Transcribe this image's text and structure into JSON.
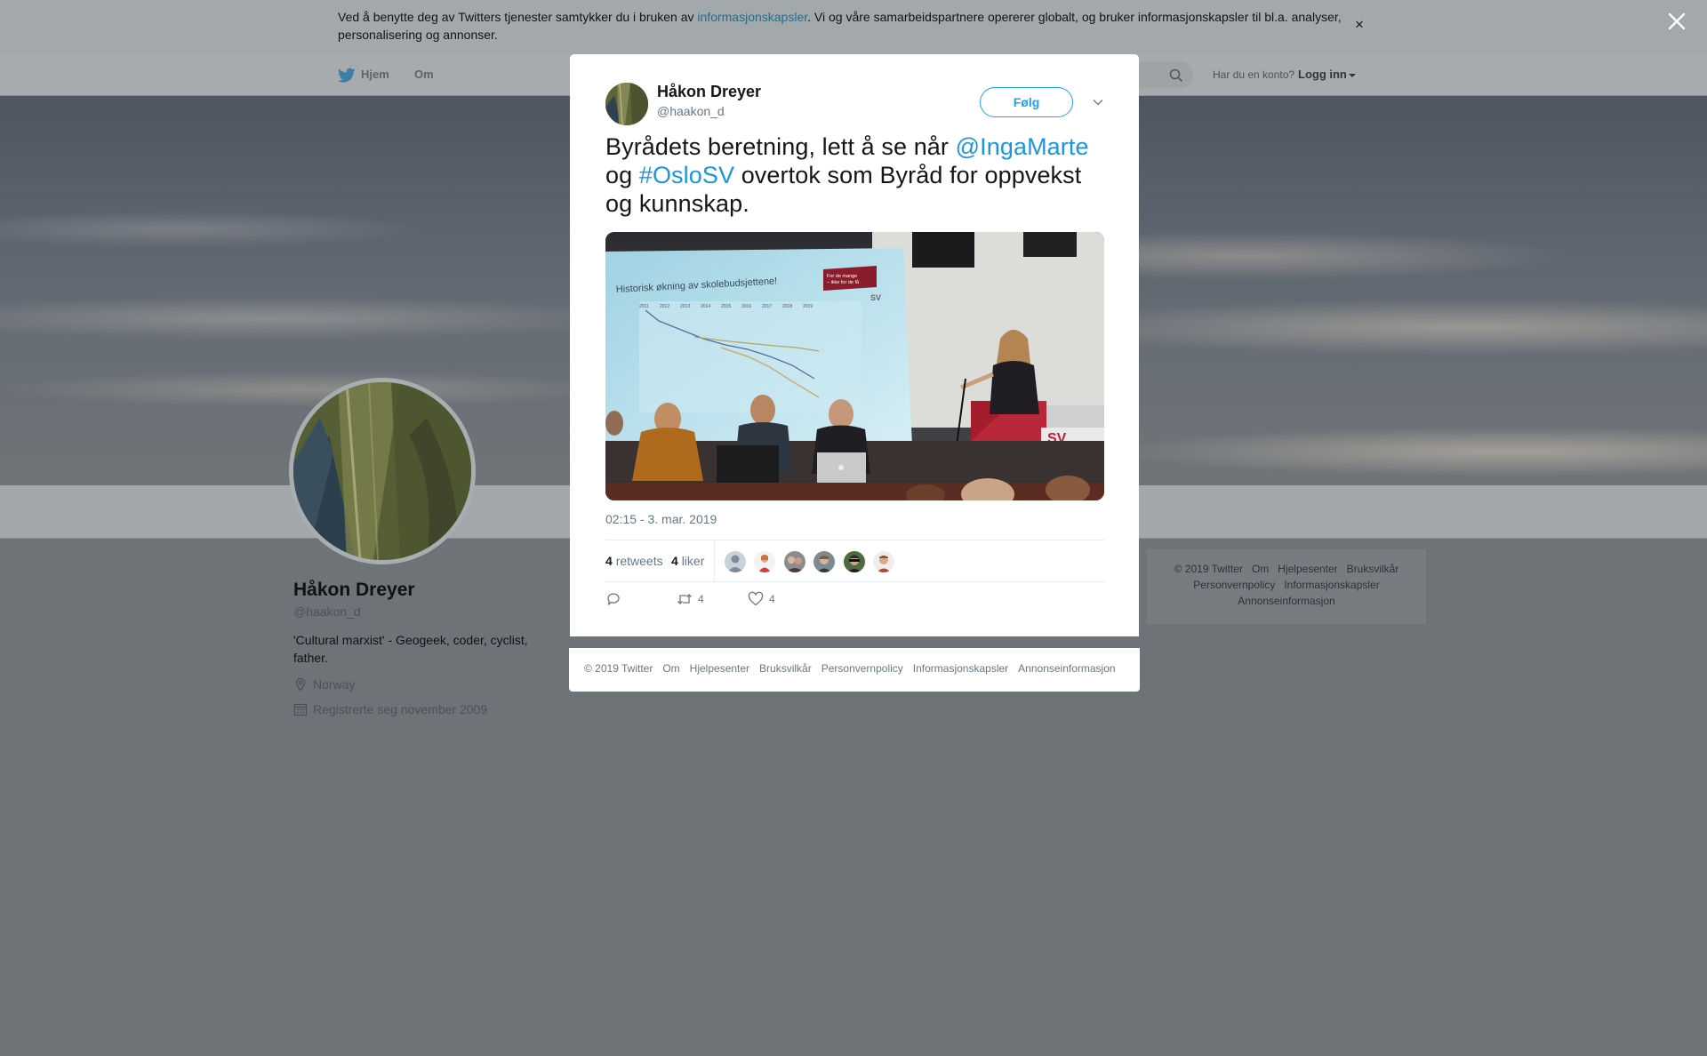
{
  "cookie": {
    "text_before": "Ved å benytte deg av Twitters tjenester samtykker du i bruken av ",
    "link": "informasjonskapsler",
    "text_after": ". Vi og våre samarbeidspartnere opererer globalt, og bruker informasjonskapsler til bl.a. analyser, personalisering og annonser.",
    "close": "×"
  },
  "nav": {
    "home": "Hjem",
    "about": "Om",
    "account_prompt": "Har du en konto?",
    "login": "Logg inn"
  },
  "profile": {
    "name": "Håkon Dreyer",
    "handle": "@haakon_d",
    "bio": "'Cultural marxist' - Geogeek, coder, cyclist, father.",
    "location": "Norway",
    "joined": "Registrerte seg november 2009"
  },
  "side_footer": {
    "row1": [
      "© 2019 Twitter",
      "Om",
      "Hjelpesenter",
      "Bruksvilkår"
    ],
    "row2": [
      "Personvernpolicy",
      "Informasjonskapsler"
    ],
    "row3": [
      "Annonseinformasjon"
    ]
  },
  "tweet": {
    "author_name": "Håkon Dreyer",
    "author_handle": "@haakon_d",
    "follow_label": "Følg",
    "text_part1": "Byrådets beretning, lett å se når ",
    "mention": "@IngaMarte",
    "text_part2": " og ",
    "hashtag": "#OsloSV",
    "text_part3": " overtok som Byråd for oppvekst og kunnskap.",
    "timestamp": "02:15 - 3. mar. 2019",
    "retweets_count": "4",
    "retweets_label": "retweets",
    "likes_count": "4",
    "likes_label": "liker",
    "action_retweet_count": "4",
    "action_like_count": "4",
    "photo": {
      "slide_title": "Historisk økning av skolebudsjettene!",
      "slide_badge_line1": "For de mange",
      "slide_badge_line2": "– ikke for de få",
      "slide_logo": "SV",
      "slide_years": [
        "2011",
        "2012",
        "2013",
        "2014",
        "2015",
        "2016",
        "2017",
        "2018",
        "2019"
      ],
      "podium_logo": "SV"
    }
  },
  "modal_footer": [
    "© 2019 Twitter",
    "Om",
    "Hjelpesenter",
    "Bruksvilkår",
    "Personvernpolicy",
    "Informasjonskapsler",
    "Annonseinformasjon"
  ],
  "colors": {
    "link": "#1b95e0",
    "follow": "#1da1f2",
    "overlay": "#6e7378"
  }
}
